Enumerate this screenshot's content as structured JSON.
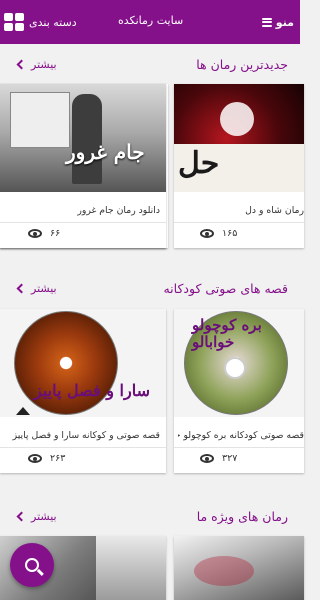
{
  "header": {
    "menu_label": "منو",
    "site_title": "سایت رمانکده",
    "category_label": "دسته بندی"
  },
  "more_label": "بیشتر",
  "sections": [
    {
      "title": "جدیدترین رمان ها",
      "cards": [
        {
          "caption": "رمان شاه و دل",
          "views": "۱۶۵",
          "cover_text": "حل"
        },
        {
          "caption": "دانلود رمان جام غرور",
          "views": "۶۶",
          "cover_text": "جام غرور"
        }
      ]
    },
    {
      "title": "قصه های صوتی کودکانه",
      "cards": [
        {
          "caption": "قصه صوتی کودکانه بره کوچولو خواب...",
          "views": "۳۲۷",
          "cover_text": "بره کوچولو خوابالو"
        },
        {
          "caption": "قصه صوتی و کوکانه سارا و فصل پاییز",
          "views": "۲۶۳",
          "cover_text": "سارا و فصل پاییز"
        }
      ]
    },
    {
      "title": "رمان های ویژه ما",
      "cards": []
    }
  ],
  "colors": {
    "accent": "#84108a",
    "background": "#f1f1f1"
  },
  "icons": {
    "menu": "hamburger-icon",
    "category": "grid-icon",
    "more": "chevron-left-icon",
    "views": "eye-icon",
    "search": "search-icon"
  }
}
